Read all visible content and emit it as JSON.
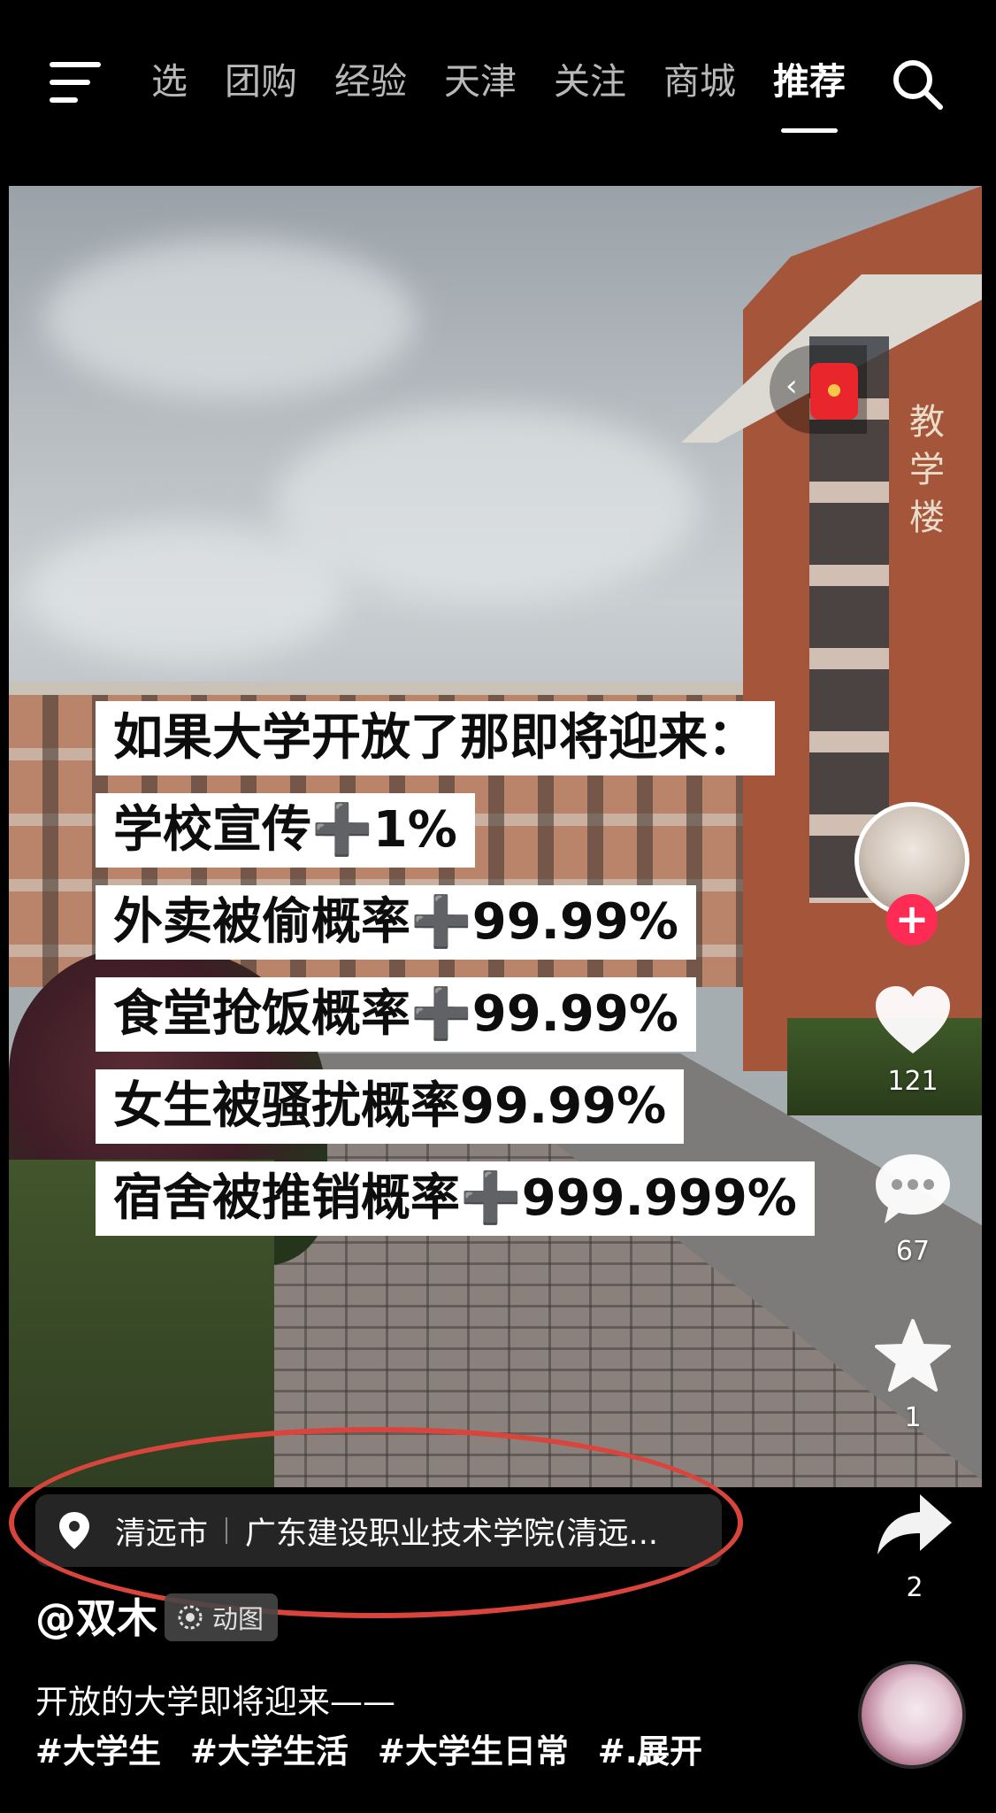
{
  "nav": {
    "tabs": [
      {
        "label": "选"
      },
      {
        "label": "团购"
      },
      {
        "label": "经验"
      },
      {
        "label": "天津"
      },
      {
        "label": "关注"
      },
      {
        "label": "商城"
      },
      {
        "label": "推荐"
      }
    ],
    "active_tab": "推荐",
    "menu_icon": "menu-icon",
    "search_icon": "search-icon"
  },
  "video": {
    "building_sign": "教学楼",
    "captions": [
      "如果大学开放了那即将迎来：",
      "学校宣传➕1%",
      "外卖被偷概率➕99.99%",
      "食堂抢饭概率➕99.99%",
      "女生被骚扰概率99.99%",
      "宿舍被推销概率➕999.999%"
    ]
  },
  "rail": {
    "like_count": "121",
    "comment_count": "67",
    "favorite_count": "1",
    "share_count": "2",
    "follow_symbol": "+"
  },
  "location": {
    "city": "清远市",
    "place": "广东建设职业技术学院(清远..."
  },
  "post": {
    "author": "@双木",
    "badge": "动图",
    "description": "开放的大学即将迎来——",
    "hashtags": [
      "#大学生",
      "#大学生活",
      "#大学生日常",
      "#..."
    ],
    "expand_label": "展开"
  },
  "colors": {
    "accent_red": "#fe2c55",
    "highlight_ellipse": "#d9453d",
    "background": "#000000"
  }
}
